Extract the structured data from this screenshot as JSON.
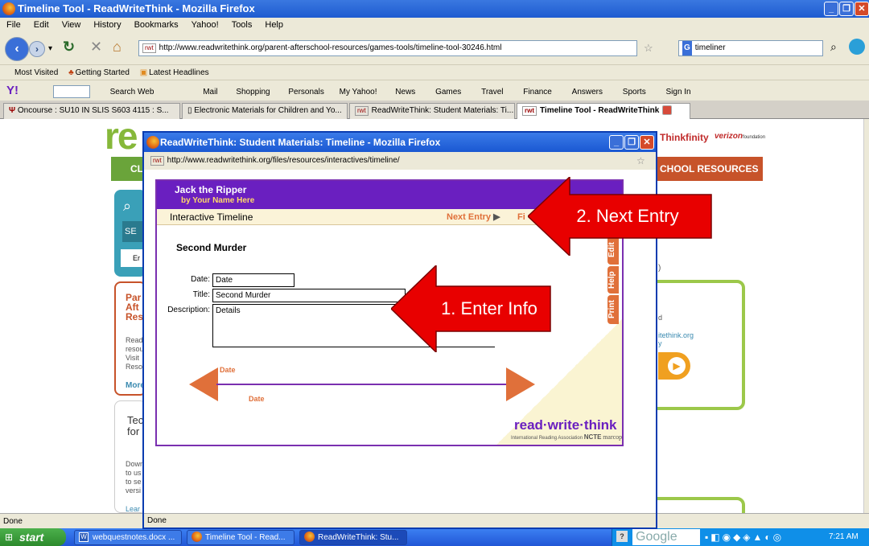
{
  "main_window": {
    "title": "Timeline Tool - ReadWriteThink - Mozilla Firefox"
  },
  "menu": [
    "File",
    "Edit",
    "View",
    "History",
    "Bookmarks",
    "Yahoo!",
    "Tools",
    "Help"
  ],
  "nav": {
    "url": "http://www.readwritethink.org/parent-afterschool-resources/games-tools/timeline-tool-30246.html",
    "search_value": "timeliner",
    "url_badge": "rwt"
  },
  "bookmarks": [
    "Most Visited",
    "Getting Started",
    "Latest Headlines"
  ],
  "yahoo_toolbar": {
    "items": [
      "Search Web",
      "Mail",
      "Shopping",
      "Personals",
      "My Yahoo!",
      "News",
      "Games",
      "Travel",
      "Finance",
      "Answers",
      "Sports",
      "Sign In"
    ]
  },
  "tabs": [
    {
      "label": "Oncourse : SU10 IN SLIS S603 4115 : S..."
    },
    {
      "label": "Electronic Materials for Children and Yo..."
    },
    {
      "label": "ReadWriteThink: Student Materials: Ti..."
    },
    {
      "label": "Timeline Tool - ReadWriteThink"
    }
  ],
  "background_page": {
    "logo_fragment": "re",
    "menu_left": "CL",
    "menu_right": "CHOOL RESOURCES",
    "thinkfinity": "Thinkfinity",
    "verizon": "verizon",
    "verizon_sub": "foundation",
    "left_text": [
      "Par",
      "Aft",
      "Res"
    ],
    "left_body": [
      "Read",
      "resou",
      "Visit",
      "Resol"
    ],
    "more": "More",
    "tec": [
      "Tec",
      "for"
    ],
    "down": [
      "Down",
      "to us",
      "to se",
      "versi"
    ],
    "lear": "Lear",
    "se": "SE",
    "er": "Er",
    "right_paren": ")",
    "right_d": "d",
    "right_link": "itethink.org",
    "right_y": "y"
  },
  "popup": {
    "title": "ReadWriteThink: Student Materials: Timeline - Mozilla Firefox",
    "url": "http://www.readwritethink.org/files/resources/interactives/timeline/",
    "status": "Done"
  },
  "timeline_app": {
    "project_title": "Jack the Ripper",
    "byline": "by  Your Name Here",
    "bar_label": "Interactive Timeline",
    "next_entry": "Next Entry",
    "bar_fi": "Fi",
    "entry_heading": "Second Murder",
    "date_label": "Date:",
    "date_value": "Date",
    "title_label": "Title:",
    "title_value": "Second Murder",
    "desc_label": "Description:",
    "desc_value": "Details",
    "side_tabs": [
      "Edit",
      "Help",
      "Print"
    ],
    "timeline_date_top": "Date",
    "timeline_date_bottom": "Date",
    "brand": "read·write·think",
    "brand_sub": [
      "International Reading Association",
      "NCTE",
      "marcopolo"
    ]
  },
  "callouts": {
    "next_entry": "2. Next Entry",
    "enter_info": "1. Enter Info"
  },
  "status": "Done",
  "taskbar": {
    "start": "start",
    "items": [
      "webquestnotes.docx ...",
      "Timeline Tool - Read...",
      "ReadWriteThink: Stu..."
    ],
    "google": "Google",
    "clock": "7:21 AM"
  },
  "colors": {
    "app_purple": "#6a1fc0",
    "timeline_orange": "#e0703a",
    "callout_red": "#e80000",
    "xp_blue": "#1a58d2"
  }
}
